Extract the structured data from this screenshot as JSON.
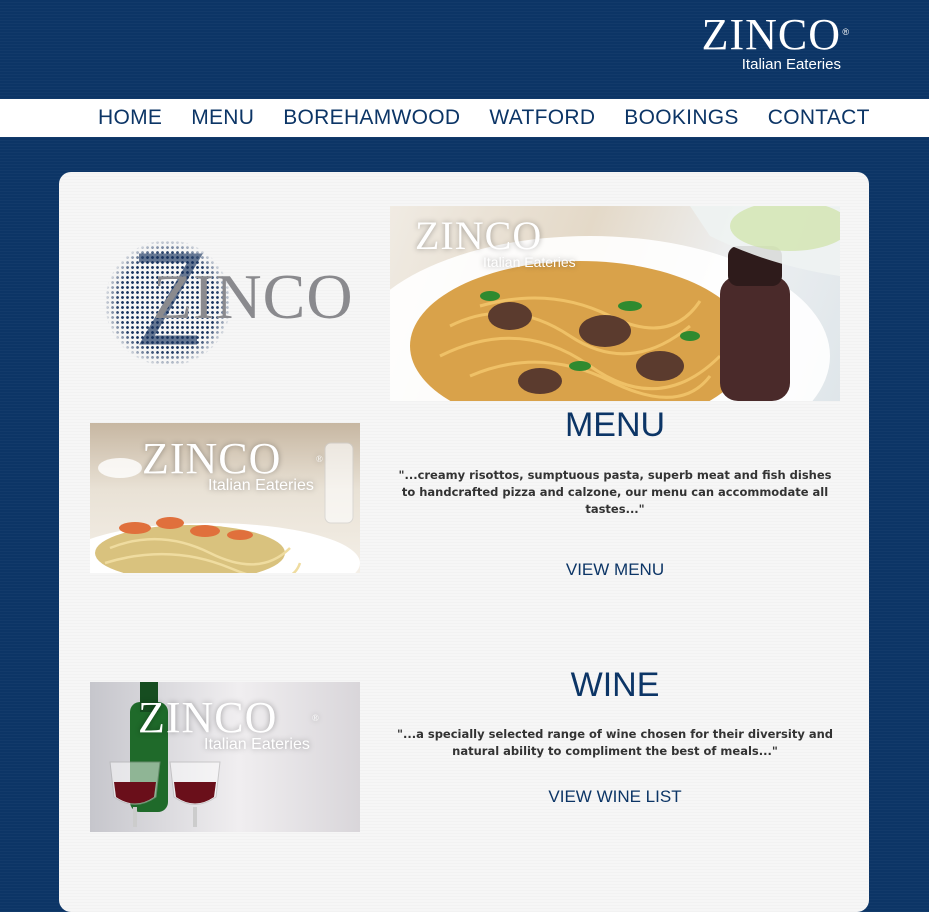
{
  "brand": {
    "name": "ZINCO",
    "registered": "®",
    "subtitle": "Italian Eateries"
  },
  "nav": {
    "items": [
      {
        "label": "HOME"
      },
      {
        "label": "MENU"
      },
      {
        "label": "BOREHAMWOOD"
      },
      {
        "label": "WATFORD"
      },
      {
        "label": "BOOKINGS"
      },
      {
        "label": "CONTACT"
      }
    ]
  },
  "logo": {
    "text": "ZINCO"
  },
  "images": {
    "hero": {
      "name": "ZINCO",
      "subtitle": "Italian Eateries"
    },
    "menu": {
      "name": "ZINCO",
      "registered": "®",
      "subtitle": "Italian Eateries"
    },
    "wine": {
      "name": "ZINCO",
      "registered": "®",
      "subtitle": "Italian Eateries"
    }
  },
  "menu_section": {
    "title": "MENU",
    "description": "\"...creamy risottos, sumptuous pasta, superb meat and fish dishes to handcrafted pizza and calzone, our menu can accommodate all tastes...\"",
    "link": "VIEW MENU"
  },
  "wine_section": {
    "title": "WINE",
    "description": "\"...a specially selected range of wine chosen for their diversity and natural ability to compliment the best of meals...\"",
    "link": "VIEW WINE LIST"
  },
  "colors": {
    "navy": "#0c3566",
    "panel": "#f6f6f6",
    "white": "#ffffff"
  }
}
